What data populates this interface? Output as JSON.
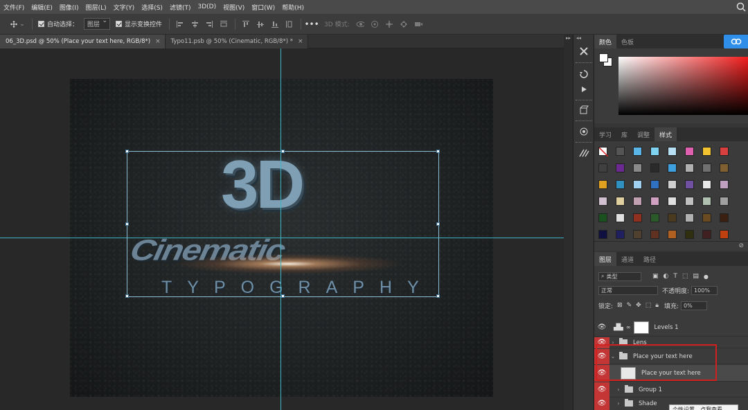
{
  "menubar": {
    "items": [
      "文件(F)",
      "编辑(E)",
      "图像(I)",
      "图层(L)",
      "文字(Y)",
      "选择(S)",
      "滤镜(T)",
      "3D(D)",
      "视图(V)",
      "窗口(W)",
      "帮助(H)"
    ]
  },
  "options": {
    "auto_select_label": "自动选择：",
    "auto_select_value": "图层",
    "show_transform_label": "显示变换控件",
    "mode_3d_label": "3D 模式:"
  },
  "tabs": [
    {
      "label": "06_3D.psd @ 50% (Place your text here, RGB/8*)",
      "close": "×"
    },
    {
      "label": "Typo11.psb @ 50% (Cinematic, RGB/8*) *",
      "close": "×"
    }
  ],
  "canvas": {
    "title_3d": "3D",
    "title_cinematic": "Cinematic",
    "title_typography": "TYPOGRAPHY"
  },
  "color_panel": {
    "tabs": [
      "颜色",
      "色板"
    ],
    "foreground": "#ffffff",
    "background": "#ffffff",
    "hue": "#f21d1d"
  },
  "styles_panel": {
    "tabs": [
      "学习",
      "库",
      "调整",
      "样式"
    ]
  },
  "layers_panel": {
    "tabs": [
      "图层",
      "通道",
      "路径"
    ],
    "filter_label": "类型",
    "blend_mode": "正常",
    "opacity_label": "不透明度:",
    "opacity_value": "100%",
    "lock_label": "锁定:",
    "fill_label": "填充:",
    "fill_value": "0%",
    "layers": [
      {
        "name": "Levels 1",
        "type": "adjustment"
      },
      {
        "name": "Lens",
        "type": "folder"
      },
      {
        "name": "Place your text here",
        "type": "folder-open"
      },
      {
        "name": "Place your text here",
        "type": "smart-object"
      },
      {
        "name": "Group 1",
        "type": "folder"
      },
      {
        "name": "Shade",
        "type": "folder"
      }
    ],
    "tooltip": "个性设置，点我查看"
  }
}
